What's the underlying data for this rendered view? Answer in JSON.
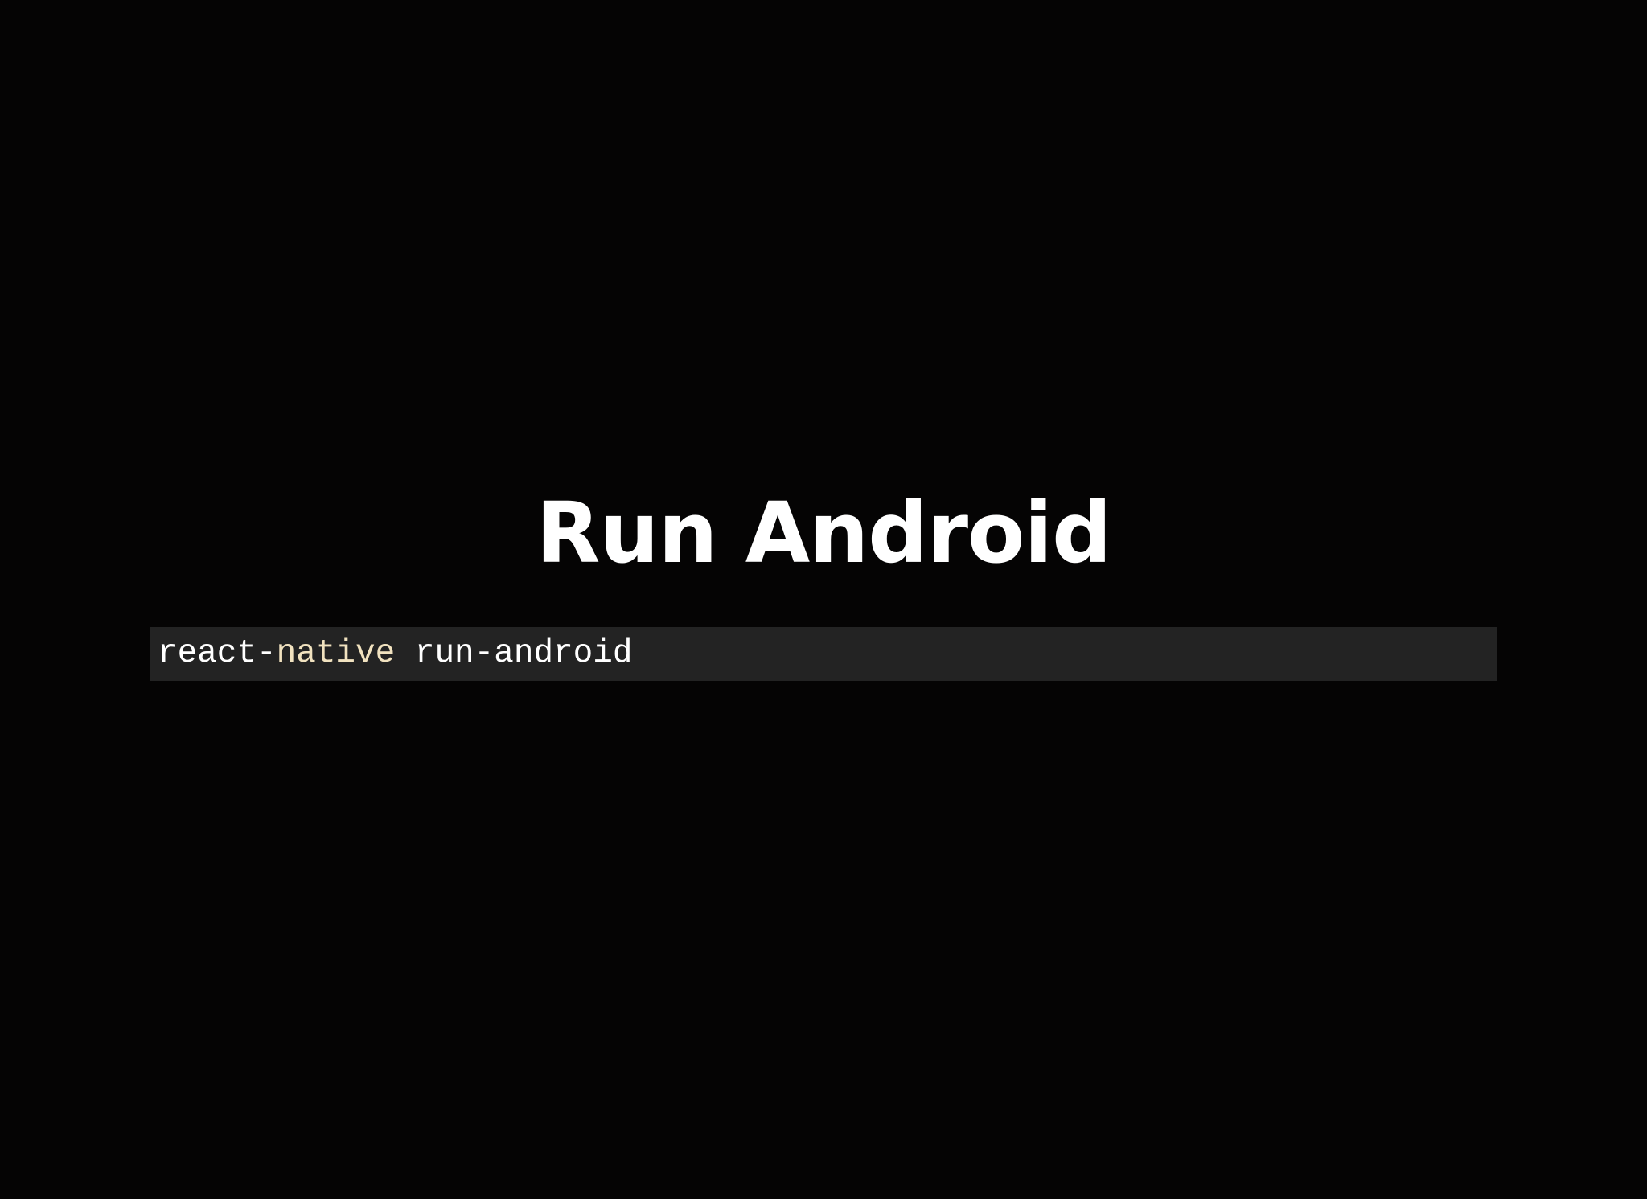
{
  "slide": {
    "title": "Run Android",
    "code": {
      "tokens": [
        {
          "text": "react-",
          "kind": "plain"
        },
        {
          "text": "native",
          "kind": "keyword"
        },
        {
          "text": " run-android",
          "kind": "plain"
        }
      ]
    }
  },
  "colors": {
    "background": "#050404",
    "code_background": "#232323",
    "title_text": "#ffffff",
    "code_text": "#ffffff",
    "code_keyword": "#f1e2bf"
  }
}
